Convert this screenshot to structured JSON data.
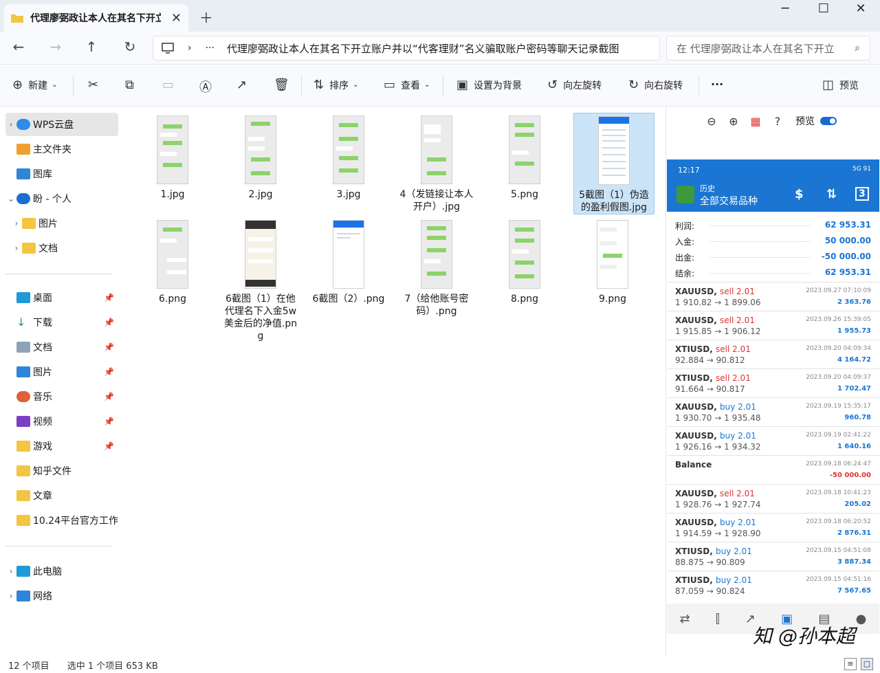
{
  "window": {
    "tab_title": "代理廖弼政让本人在其名下开立",
    "minimize": "─",
    "maximize": "☐",
    "close": "✕"
  },
  "address": {
    "more": "···",
    "path": "代理廖弼政让本人在其名下开立账户并以“代客理财”名义骗取账户密码等聊天记录截图",
    "search_placeholder": "在 代理廖弼政让本人在其名下开立"
  },
  "toolbar": {
    "new": "新建",
    "sort": "排序",
    "view": "查看",
    "set_bg": "设置为背景",
    "rotate_left": "向左旋转",
    "rotate_right": "向右旋转",
    "more": "···",
    "preview": "预览"
  },
  "sidebar": {
    "items": [
      {
        "label": "WPS云盘",
        "icon": "cloud-icon"
      },
      {
        "label": "主文件夹",
        "icon": "home-icon"
      },
      {
        "label": "图库",
        "icon": "gallery-icon"
      },
      {
        "label": "盼 - 个人",
        "icon": "onedrive-icon"
      },
      {
        "label": "图片",
        "icon": "folder-icon"
      },
      {
        "label": "文档",
        "icon": "folder-icon"
      },
      {
        "label": "桌面",
        "icon": "desktop-icon"
      },
      {
        "label": "下载",
        "icon": "download-icon"
      },
      {
        "label": "文档",
        "icon": "document-icon"
      },
      {
        "label": "图片",
        "icon": "pictures-icon"
      },
      {
        "label": "音乐",
        "icon": "music-icon"
      },
      {
        "label": "视频",
        "icon": "video-icon"
      },
      {
        "label": "游戏",
        "icon": "folder-icon"
      },
      {
        "label": "知乎文件",
        "icon": "folder-icon"
      },
      {
        "label": "文章",
        "icon": "folder-icon"
      },
      {
        "label": "10.24平台官方工作",
        "icon": "folder-icon"
      },
      {
        "label": "此电脑",
        "icon": "pc-icon"
      },
      {
        "label": "网络",
        "icon": "network-icon"
      }
    ]
  },
  "files": [
    {
      "name": "1.jpg"
    },
    {
      "name": "2.jpg"
    },
    {
      "name": "3.jpg"
    },
    {
      "name": "4（发链接让本人开户）.jpg"
    },
    {
      "name": "5.png"
    },
    {
      "name": "5截图（1）伪造的盈利假图.jpg"
    },
    {
      "name": "6.png"
    },
    {
      "name": "6截图（1）在他代理名下入金5w美金后的净值.png"
    },
    {
      "name": "6截图（2）.png"
    },
    {
      "name": "7（给他账号密码）.png"
    },
    {
      "name": "8.png"
    },
    {
      "name": "9.png"
    }
  ],
  "preview": {
    "label": "预览",
    "phone": {
      "time": "12:17",
      "status": "5G 91",
      "subtitle": "历史",
      "title": "全部交易品种",
      "summary": [
        {
          "label": "利润:",
          "value": "62 953.31"
        },
        {
          "label": "入金:",
          "value": "50 000.00"
        },
        {
          "label": "出金:",
          "value": "-50 000.00"
        },
        {
          "label": "结余:",
          "value": "62 953.31"
        }
      ],
      "trades": [
        {
          "sym": "XAUUSD,",
          "side": "sell 2.01",
          "kind": "sell",
          "px": "1 910.82 → 1 899.06",
          "dt": "2023.09.27 07:10:09",
          "pl": "2 363.76"
        },
        {
          "sym": "XAUUSD,",
          "side": "sell 2.01",
          "kind": "sell",
          "px": "1 915.85 → 1 906.12",
          "dt": "2023.09.26 15:39:05",
          "pl": "1 955.73"
        },
        {
          "sym": "XTIUSD,",
          "side": "sell 2.01",
          "kind": "sell",
          "px": "92.884 → 90.812",
          "dt": "2023.09.20 04:09:34",
          "pl": "4 164.72"
        },
        {
          "sym": "XTIUSD,",
          "side": "sell 2.01",
          "kind": "sell",
          "px": "91.664 → 90.817",
          "dt": "2023.09.20 04:09:37",
          "pl": "1 702.47"
        },
        {
          "sym": "XAUUSD,",
          "side": "buy 2.01",
          "kind": "buy",
          "px": "1 930.70 → 1 935.48",
          "dt": "2023.09.19 15:35:17",
          "pl": "960.78"
        },
        {
          "sym": "XAUUSD,",
          "side": "buy 2.01",
          "kind": "buy",
          "px": "1 926.16 → 1 934.32",
          "dt": "2023.09.19 02:41:22",
          "pl": "1 640.16"
        },
        {
          "sym": "Balance",
          "side": "",
          "kind": "balance",
          "px": "",
          "dt": "2023.09.18 06:24:47",
          "pl": "-50 000.00"
        },
        {
          "sym": "XAUUSD,",
          "side": "sell 2.01",
          "kind": "sell",
          "px": "1 928.76 → 1 927.74",
          "dt": "2023.09.18 10:41:23",
          "pl": "205.02"
        },
        {
          "sym": "XAUUSD,",
          "side": "buy 2.01",
          "kind": "buy",
          "px": "1 914.59 → 1 928.90",
          "dt": "2023.09.18 06:20:52",
          "pl": "2 876.31"
        },
        {
          "sym": "XTIUSD,",
          "side": "buy 2.01",
          "kind": "buy",
          "px": "88.875 → 90.809",
          "dt": "2023.09.15 04:51:08",
          "pl": "3 887.34"
        },
        {
          "sym": "XTIUSD,",
          "side": "buy 2.01",
          "kind": "buy",
          "px": "87.059 → 90.824",
          "dt": "2023.09.15 04:51:16",
          "pl": "7 567.65"
        }
      ]
    },
    "watermark": "知 @孙本超"
  },
  "status": {
    "count": "12 个项目",
    "selected": "选中 1 个项目  653 KB"
  }
}
